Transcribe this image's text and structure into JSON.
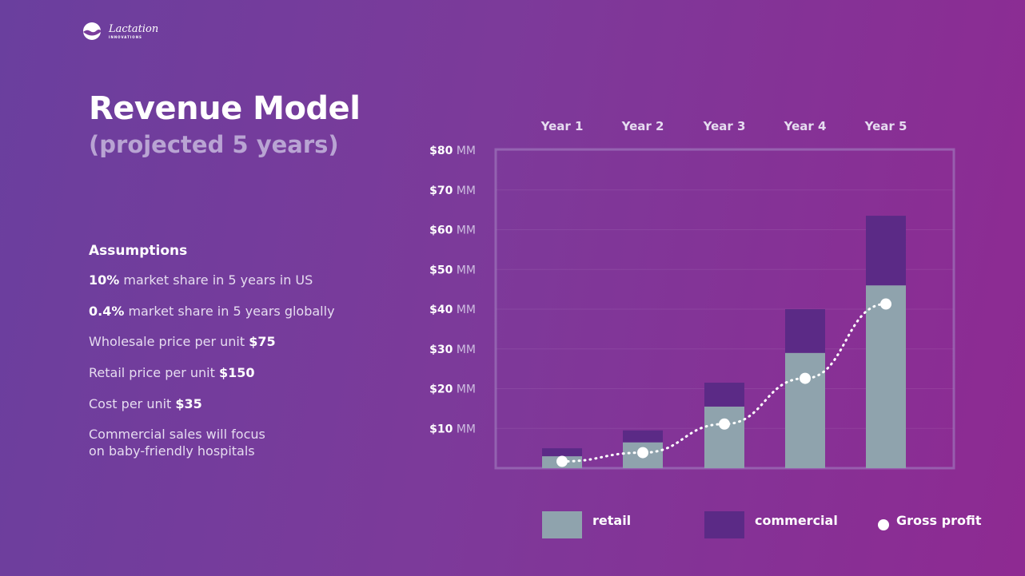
{
  "logo": {
    "name": "Lactation",
    "sub": "INNOVATIONS"
  },
  "title": "Revenue Model",
  "subtitle": "(projected 5 years)",
  "assumptions": {
    "heading": "Assumptions",
    "items": [
      {
        "bold": "10%",
        "text": " market share in 5 years in US",
        "bold_first": true
      },
      {
        "bold": "0.4%",
        "text": " market share in 5 years globally",
        "bold_first": true
      },
      {
        "bold": "$75",
        "text": "Wholesale price per unit ",
        "bold_first": false
      },
      {
        "bold": "$150",
        "text": "Retail price per unit ",
        "bold_first": false
      },
      {
        "bold": "$35",
        "text": "Cost per unit ",
        "bold_first": false
      },
      {
        "bold": "",
        "text": "Commercial sales will focus\non baby-friendly hospitals",
        "bold_first": false
      }
    ]
  },
  "colors": {
    "retail": "#8fa3ad",
    "commercial": "#5b2a86",
    "profit": "#ffffff",
    "frame": "#a17ec0"
  },
  "chart_data": {
    "type": "bar",
    "stacked": true,
    "categories": [
      "Year 1",
      "Year 2",
      "Year 3",
      "Year 4",
      "Year 5"
    ],
    "series": [
      {
        "name": "retail",
        "values": [
          3,
          6.5,
          15.5,
          29,
          46
        ]
      },
      {
        "name": "commercial",
        "values": [
          2,
          3,
          6,
          11,
          17.5
        ]
      }
    ],
    "overlay": {
      "name": "Gross profit",
      "type": "line-dotted",
      "values": [
        1.7,
        3.9,
        11.1,
        22.6,
        41.3
      ]
    },
    "ylim": [
      0,
      80
    ],
    "yticks": [
      {
        "value": 10,
        "amount": "$10",
        "unit": " MM"
      },
      {
        "value": 20,
        "amount": "$20",
        "unit": " MM"
      },
      {
        "value": 30,
        "amount": "$30",
        "unit": " MM"
      },
      {
        "value": 40,
        "amount": "$40",
        "unit": " MM"
      },
      {
        "value": 50,
        "amount": "$50",
        "unit": " MM"
      },
      {
        "value": 60,
        "amount": "$60",
        "unit": " MM"
      },
      {
        "value": 70,
        "amount": "$70",
        "unit": " MM"
      },
      {
        "value": 80,
        "amount": "$80",
        "unit": " MM"
      }
    ],
    "x_labels_position": "top",
    "legend_position": "bottom",
    "grid": true
  }
}
